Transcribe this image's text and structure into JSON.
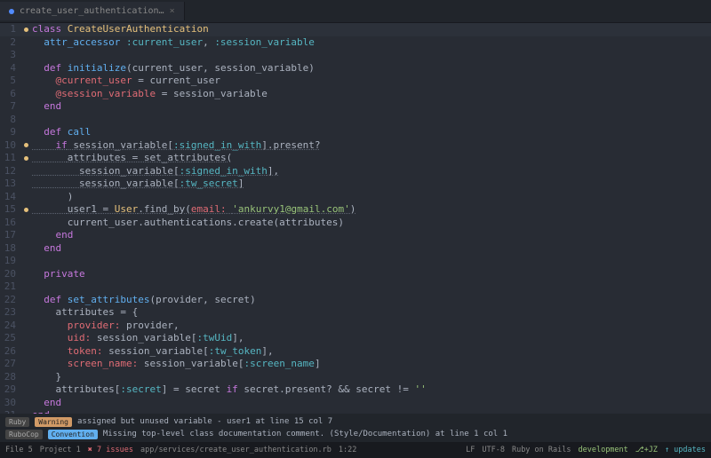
{
  "tab": {
    "filename": "create_user_authentication…"
  },
  "markers": {
    "1": true,
    "10": true,
    "11": true,
    "15": true
  },
  "cursor_line": 1,
  "code": [
    [
      [
        "kw",
        "class"
      ],
      [
        "id",
        " "
      ],
      [
        "cls",
        "CreateUserAuthentication"
      ]
    ],
    [
      [
        "id",
        "  "
      ],
      [
        "fn",
        "attr_accessor"
      ],
      [
        "id",
        " "
      ],
      [
        "sym",
        ":current_user"
      ],
      [
        "op",
        ", "
      ],
      [
        "sym",
        ":session_variable"
      ]
    ],
    [],
    [
      [
        "id",
        "  "
      ],
      [
        "def",
        "def"
      ],
      [
        "id",
        " "
      ],
      [
        "fn",
        "initialize"
      ],
      [
        "op",
        "("
      ],
      [
        "id",
        "current_user, session_variable"
      ],
      [
        "op",
        ")"
      ]
    ],
    [
      [
        "id",
        "    "
      ],
      [
        "ivar",
        "@current_user"
      ],
      [
        "op",
        " = "
      ],
      [
        "id",
        "current_user"
      ]
    ],
    [
      [
        "id",
        "    "
      ],
      [
        "ivar",
        "@session_variable"
      ],
      [
        "op",
        " = "
      ],
      [
        "id",
        "session_variable"
      ]
    ],
    [
      [
        "id",
        "  "
      ],
      [
        "kw",
        "end"
      ]
    ],
    [],
    [
      [
        "id",
        "  "
      ],
      [
        "def",
        "def"
      ],
      [
        "id",
        " "
      ],
      [
        "fn",
        "call"
      ]
    ],
    [
      [
        "id",
        "    "
      ],
      [
        "kw",
        "if"
      ],
      [
        "id",
        " session_variable["
      ],
      [
        "sym",
        ":signed_in_with"
      ],
      [
        "id",
        "].present?"
      ]
    ],
    [
      [
        "id",
        "      "
      ],
      [
        "id",
        "attributes"
      ],
      [
        "op",
        " = "
      ],
      [
        "id",
        "set_attributes("
      ]
    ],
    [
      [
        "id",
        "        session_variable["
      ],
      [
        "sym",
        ":signed_in_with"
      ],
      [
        "id",
        "],"
      ]
    ],
    [
      [
        "id",
        "        session_variable["
      ],
      [
        "sym",
        ":tw_secret"
      ],
      [
        "id",
        "]"
      ]
    ],
    [
      [
        "id",
        "      )"
      ]
    ],
    [
      [
        "id",
        "      "
      ],
      [
        "id",
        "user1"
      ],
      [
        "op",
        " = "
      ],
      [
        "cls",
        "User"
      ],
      [
        "id",
        ".find_by("
      ],
      [
        "key",
        "email:"
      ],
      [
        "id",
        " "
      ],
      [
        "str",
        "'ankurvy1@gmail.com'"
      ],
      [
        "id",
        ")"
      ]
    ],
    [
      [
        "id",
        "      current_user.authentications.create(attributes)"
      ]
    ],
    [
      [
        "id",
        "    "
      ],
      [
        "kw",
        "end"
      ]
    ],
    [
      [
        "id",
        "  "
      ],
      [
        "kw",
        "end"
      ]
    ],
    [],
    [
      [
        "id",
        "  "
      ],
      [
        "kw",
        "private"
      ]
    ],
    [],
    [
      [
        "id",
        "  "
      ],
      [
        "def",
        "def"
      ],
      [
        "id",
        " "
      ],
      [
        "fn",
        "set_attributes"
      ],
      [
        "op",
        "("
      ],
      [
        "id",
        "provider, secret"
      ],
      [
        "op",
        ")"
      ]
    ],
    [
      [
        "id",
        "    attributes = {"
      ]
    ],
    [
      [
        "id",
        "      "
      ],
      [
        "key",
        "provider:"
      ],
      [
        "id",
        " provider,"
      ]
    ],
    [
      [
        "id",
        "      "
      ],
      [
        "key",
        "uid:"
      ],
      [
        "id",
        " session_variable["
      ],
      [
        "sym",
        ":twUid"
      ],
      [
        "id",
        "],"
      ]
    ],
    [
      [
        "id",
        "      "
      ],
      [
        "key",
        "token:"
      ],
      [
        "id",
        " session_variable["
      ],
      [
        "sym",
        ":tw_token"
      ],
      [
        "id",
        "],"
      ]
    ],
    [
      [
        "id",
        "      "
      ],
      [
        "key",
        "screen_name:"
      ],
      [
        "id",
        " session_variable["
      ],
      [
        "sym",
        ":screen_name"
      ],
      [
        "id",
        "]"
      ]
    ],
    [
      [
        "id",
        "    }"
      ]
    ],
    [
      [
        "id",
        "    attributes["
      ],
      [
        "sym",
        ":secret"
      ],
      [
        "id",
        "] = secret "
      ],
      [
        "kw",
        "if"
      ],
      [
        "id",
        " secret.present? "
      ],
      [
        "op",
        "&&"
      ],
      [
        "id",
        " secret != "
      ],
      [
        "str",
        "''"
      ]
    ],
    [
      [
        "id",
        "  "
      ],
      [
        "kw",
        "end"
      ]
    ],
    [
      [
        "kw",
        "end"
      ]
    ],
    []
  ],
  "lint": {
    "row1": {
      "b1": "Ruby",
      "b2": "Warning",
      "msg": "assigned but unused variable - user1 at line 15 col 7"
    },
    "row2": {
      "b1": "RuboCop",
      "b2": "Convention",
      "msg": "Missing top-level class documentation comment. (Style/Documentation) at line 1 col 1"
    }
  },
  "footer": {
    "file_count": "File  5",
    "project": "Project  1",
    "issues": "✖ 7 issues",
    "path": "app/services/create_user_authentication.rb",
    "pos": "1:22",
    "lf": "LF",
    "enc": "UTF-8",
    "ruby": "Ruby on Rails",
    "env": "development",
    "branch": "⎇+JZ",
    "updates": "↑ updates"
  }
}
